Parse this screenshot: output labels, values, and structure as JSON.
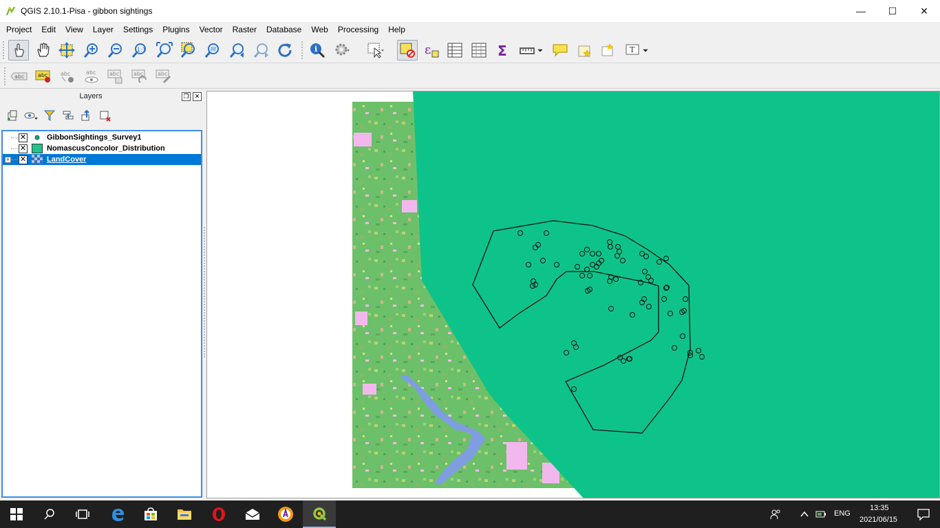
{
  "window": {
    "title": "QGIS 2.10.1-Pisa - gibbon sightings",
    "minimize_glyph": "—",
    "maximize_glyph": "☐",
    "close_glyph": "✕"
  },
  "menubar": [
    "Project",
    "Edit",
    "View",
    "Layer",
    "Settings",
    "Plugins",
    "Vector",
    "Raster",
    "Database",
    "Web",
    "Processing",
    "Help"
  ],
  "toolbar_icons": [
    "touch-zoom-pan-icon",
    "pan-hand-icon",
    "pan-to-selection-icon",
    "zoom-in-icon",
    "zoom-out-icon",
    "zoom-native-icon",
    "zoom-full-icon",
    "zoom-to-selection-icon",
    "zoom-to-layer-icon",
    "zoom-last-icon",
    "zoom-next-icon",
    "refresh-icon",
    "identify-icon",
    "run-action-icon",
    "select-features-icon",
    "deselect-icon",
    "expression-select-icon",
    "attribute-table-icon",
    "field-calculator-icon",
    "statistics-icon",
    "measure-icon",
    "map-tips-icon",
    "new-bookmark-icon",
    "show-bookmarks-icon",
    "text-annotation-icon"
  ],
  "label_toolbar": {
    "abc_text": "abc",
    "icons": [
      "label-layer-icon",
      "label-pin-icon",
      "label-highlight-icon",
      "label-show-hide-icon",
      "label-move-icon",
      "label-rotate-icon",
      "label-change-icon"
    ]
  },
  "layers_panel": {
    "title": "Layers",
    "float_glyph": "❐",
    "close_glyph": "✕",
    "tools": [
      "add-group-icon",
      "manage-visibility-icon",
      "filter-legend-icon",
      "expand-all-icon",
      "collapse-all-icon",
      "remove-layer-icon"
    ],
    "layers": [
      {
        "name": "GibbonSightings_Survey1",
        "checked": true,
        "symbol": "point",
        "color": "#17a56b"
      },
      {
        "name": "NomascusConcolor_Distribution",
        "checked": true,
        "symbol": "polygon",
        "color": "#1fc48a"
      },
      {
        "name": "LandCover",
        "checked": true,
        "symbol": "raster",
        "selected": true,
        "expandable": true
      }
    ],
    "check_glyph": "✕",
    "expand_glyph": "+"
  },
  "map": {
    "polygon_color": "#0ec389",
    "raster_base": "#6dc06a",
    "water_color": "#7f9ee0",
    "pink_color": "#f2b8ee"
  },
  "taskbar": {
    "icons": [
      "windows-start-icon",
      "search-icon",
      "task-view-icon",
      "edge-icon",
      "store-icon",
      "file-explorer-icon",
      "opera-icon",
      "mail-icon",
      "avast-icon",
      "qgis-icon"
    ],
    "language": "ENG",
    "time": "13:35",
    "date": "2021/06/15"
  }
}
